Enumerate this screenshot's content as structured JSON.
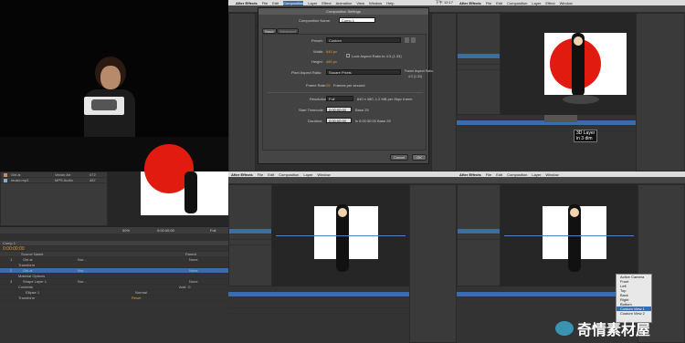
{
  "menu": {
    "app": "After Effects",
    "items": [
      "File",
      "Edit",
      "Composition",
      "Layer",
      "Effect",
      "Animation",
      "View",
      "Window",
      "Help"
    ],
    "clock": "下午 12:17"
  },
  "project": {
    "files": [
      {
        "name": "Girl.ai",
        "type": "Vector Art",
        "size": "472"
      },
      {
        "name": "music.mp3",
        "type": "MPS Audio",
        "size": "487"
      }
    ]
  },
  "timeline_left": {
    "comp_tab": "Comp 1",
    "timecode": "0:00:00:00",
    "col_source": "Source Name",
    "col_parent": "Parent",
    "layers": [
      {
        "num": "1",
        "name": "Girl.ai",
        "mode": "Nor...",
        "parent": "None"
      },
      {
        "num": "2",
        "name": "Girl.ai",
        "mode": "Nor...",
        "parent": "None"
      },
      {
        "num": "3",
        "name": "Shape Layer 1",
        "mode": "Nor...",
        "parent": "None"
      }
    ],
    "transform": "Transform",
    "reset": "Reset",
    "material": "Material Options",
    "contents": "Contents",
    "add": "Add: ⊙",
    "ellipse": "Ellipse 1",
    "normal": "Normal",
    "zoom": "50%",
    "time_readout": "0:00:00:00",
    "full": "Full"
  },
  "dialog": {
    "title": "Composition Settings",
    "comp_name_label": "Composition Name:",
    "comp_name": "Comp 1",
    "tab_basic": "Basic",
    "tab_advanced": "Advanced",
    "preset_label": "Preset:",
    "preset": "Custom",
    "width_label": "Width:",
    "width": "640 px",
    "height_label": "Height:",
    "height": "480 px",
    "lock": "Lock Aspect Ratio to 4:3 (1.33)",
    "par_label": "Pixel Aspect Ratio:",
    "par": "Square Pixels",
    "far_label": "Frame Aspect Ratio:",
    "far": "4:3 (1.33)",
    "fr_label": "Frame Rate:",
    "fr": "25",
    "fr_unit": "Frames per second",
    "res_label": "Resolution:",
    "res": "Full",
    "res_info": "640 x 480, 1.2 MB per 8bpc frame",
    "start_label": "Start Timecode:",
    "start": "0:00:00:00",
    "start_note": "Base 25",
    "dur_label": "Duration:",
    "dur": "0:00:00:00",
    "dur_note": "is 0:00:30:00  Base 25",
    "cancel": "Cancel",
    "ok": "OK"
  },
  "tooltip": {
    "line1": "3D Layer",
    "line2": "in 3 dim"
  },
  "cam_menu": {
    "items": [
      "Active Camera",
      "Front",
      "Left",
      "Top",
      "Back",
      "Right",
      "Bottom",
      "Custom View 1",
      "Custom View 2",
      "Custom View 3"
    ]
  },
  "watermark": "奇情素材屋",
  "colors": {
    "accent": "#e89a2a",
    "selection": "#3b6ea8",
    "red": "#e21b10"
  }
}
